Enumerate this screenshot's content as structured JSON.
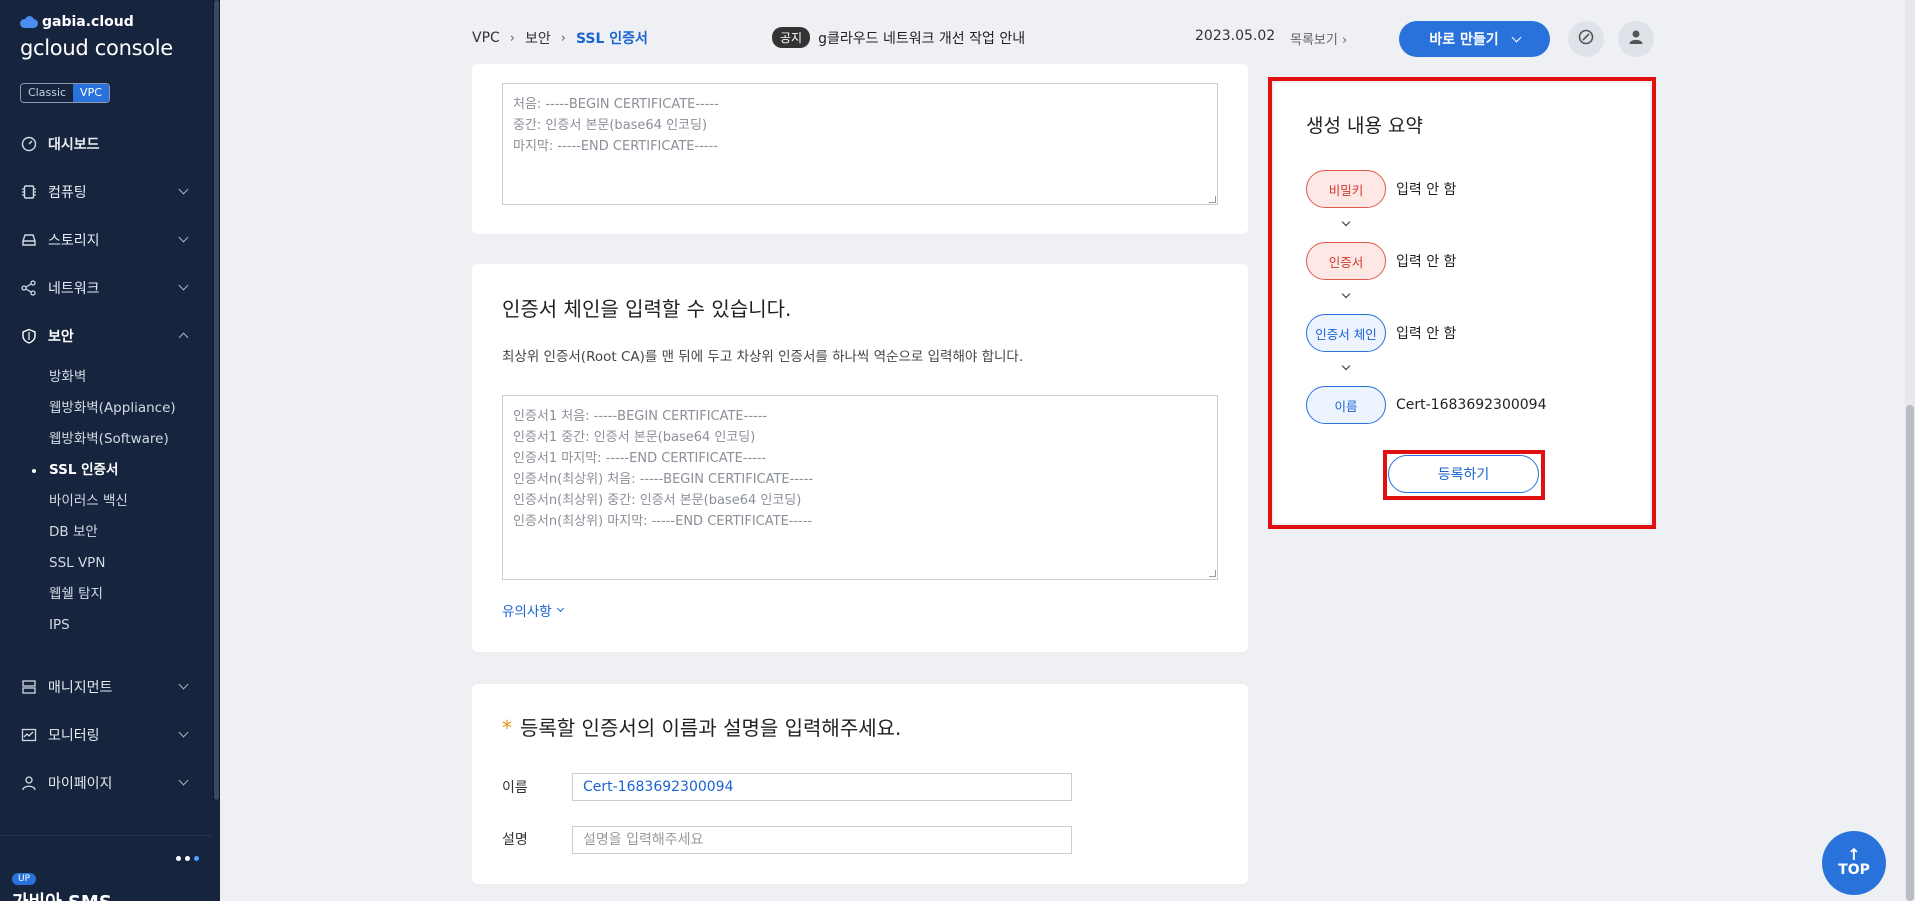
{
  "sidebar": {
    "brand_small": "gabia.cloud",
    "brand_main": "gcloud console",
    "mode": {
      "classic": "Classic",
      "vpc": "VPC"
    },
    "items": [
      {
        "label": "대시보드",
        "icon": "dashboard-icon"
      },
      {
        "label": "컴퓨팅",
        "icon": "chip-icon"
      },
      {
        "label": "스토리지",
        "icon": "storage-icon"
      },
      {
        "label": "네트워크",
        "icon": "network-icon"
      },
      {
        "label": "보안",
        "icon": "shield-icon"
      },
      {
        "label": "매니지먼트",
        "icon": "server-icon"
      },
      {
        "label": "모니터링",
        "icon": "monitor-icon"
      },
      {
        "label": "마이페이지",
        "icon": "user-icon"
      }
    ],
    "security_sub": [
      "방화벽",
      "웹방화벽(Appliance)",
      "웹방화벽(Software)",
      "SSL 인증서",
      "바이러스 백신",
      "DB 보안",
      "SSL VPN",
      "웹쉘 탐지",
      "IPS"
    ],
    "up_badge": "UP",
    "sms_brand": "가비아 SMS"
  },
  "header": {
    "breadcrumb": [
      "VPC",
      "보안",
      "SSL 인증서"
    ],
    "notice_badge": "공지",
    "notice_text": "g클라우드 네트워크 개선 작업 안내",
    "notice_date": "2023.05.02",
    "notice_more": "목록보기",
    "create_label": "바로 만들기"
  },
  "cert_card": {
    "placeholder": "처음: -----BEGIN CERTIFICATE-----\n중간: 인증서 본문(base64 인코딩)\n마지막: -----END CERTIFICATE-----"
  },
  "chain_card": {
    "title": "인증서 체인을 입력할 수 있습니다.",
    "desc": "최상위 인증서(Root CA)를 맨 뒤에 두고 차상위 인증서를 하나씩 역순으로 입력해야 합니다.",
    "placeholder": "인증서1 처음: -----BEGIN CERTIFICATE-----\n인증서1 중간: 인증서 본문(base64 인코딩)\n인증서1 마지막: -----END CERTIFICATE-----\n인증서n(최상위) 처음: -----BEGIN CERTIFICATE-----\n인증서n(최상위) 중간: 인증서 본문(base64 인코딩)\n인증서n(최상위) 마지막: -----END CERTIFICATE-----",
    "caution": "유의사항"
  },
  "name_card": {
    "star": "*",
    "title": "등록할 인증서의 이름과 설명을 입력해주세요.",
    "name_label": "이름",
    "name_value": "Cert-1683692300094",
    "desc_label": "설명",
    "desc_placeholder": "설명을 입력해주세요"
  },
  "summary": {
    "title": "생성 내용 요약",
    "steps": [
      {
        "label": "비밀키",
        "value": "입력 안 함",
        "state": "pending"
      },
      {
        "label": "인증서",
        "value": "입력 안 함",
        "state": "pending"
      },
      {
        "label": "인증서 체인",
        "value": "입력 안 함",
        "state": "done"
      },
      {
        "label": "이름",
        "value": "Cert-1683692300094",
        "state": "done"
      }
    ],
    "submit_label": "등록하기"
  },
  "top_button": "TOP",
  "colors": {
    "accent": "#2a72db",
    "sidebar": "#16243d",
    "highlight": "#e01010",
    "pending": "#d23a2d"
  }
}
